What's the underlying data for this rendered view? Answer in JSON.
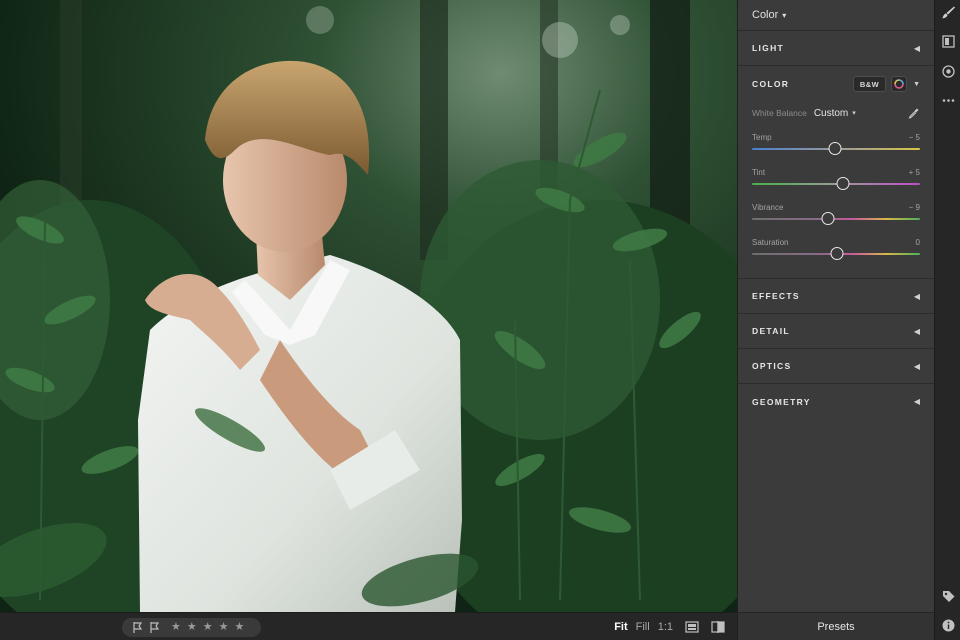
{
  "panel": {
    "mode_label": "Color",
    "sections": {
      "light": "LIGHT",
      "color": "COLOR",
      "effects": "EFFECTS",
      "detail": "DETAIL",
      "optics": "OPTICS",
      "geometry": "GEOMETRY"
    },
    "bw_button": "B&W",
    "white_balance": {
      "label": "White Balance",
      "value": "Custom"
    },
    "sliders": [
      {
        "label": "Temp",
        "value": "− 5",
        "position": 0.49,
        "track": "temp"
      },
      {
        "label": "Tint",
        "value": "+ 5",
        "position": 0.54,
        "track": "tint"
      },
      {
        "label": "Vibrance",
        "value": "− 9",
        "position": 0.45,
        "track": "vibrance"
      },
      {
        "label": "Saturation",
        "value": "0",
        "position": 0.5,
        "track": "saturation"
      }
    ]
  },
  "bottom_bar": {
    "stars": [
      "★",
      "★",
      "★",
      "★",
      "★"
    ],
    "views": {
      "fit": "Fit",
      "fill": "Fill",
      "one_to_one": "1:1"
    }
  },
  "presets_label": "Presets",
  "colors": {
    "panel_bg": "#3b3b3b",
    "toolstrip_bg": "#262626",
    "temp_track": [
      "#4a7fd0",
      "#9a9a9a",
      "#d8c44a"
    ],
    "tint_track": [
      "#46b04a",
      "#9a9a9a",
      "#c24ec8"
    ],
    "vib_track": [
      "#6e6e6e",
      "#c85a9c",
      "#d8b847",
      "#4fb05a"
    ]
  }
}
